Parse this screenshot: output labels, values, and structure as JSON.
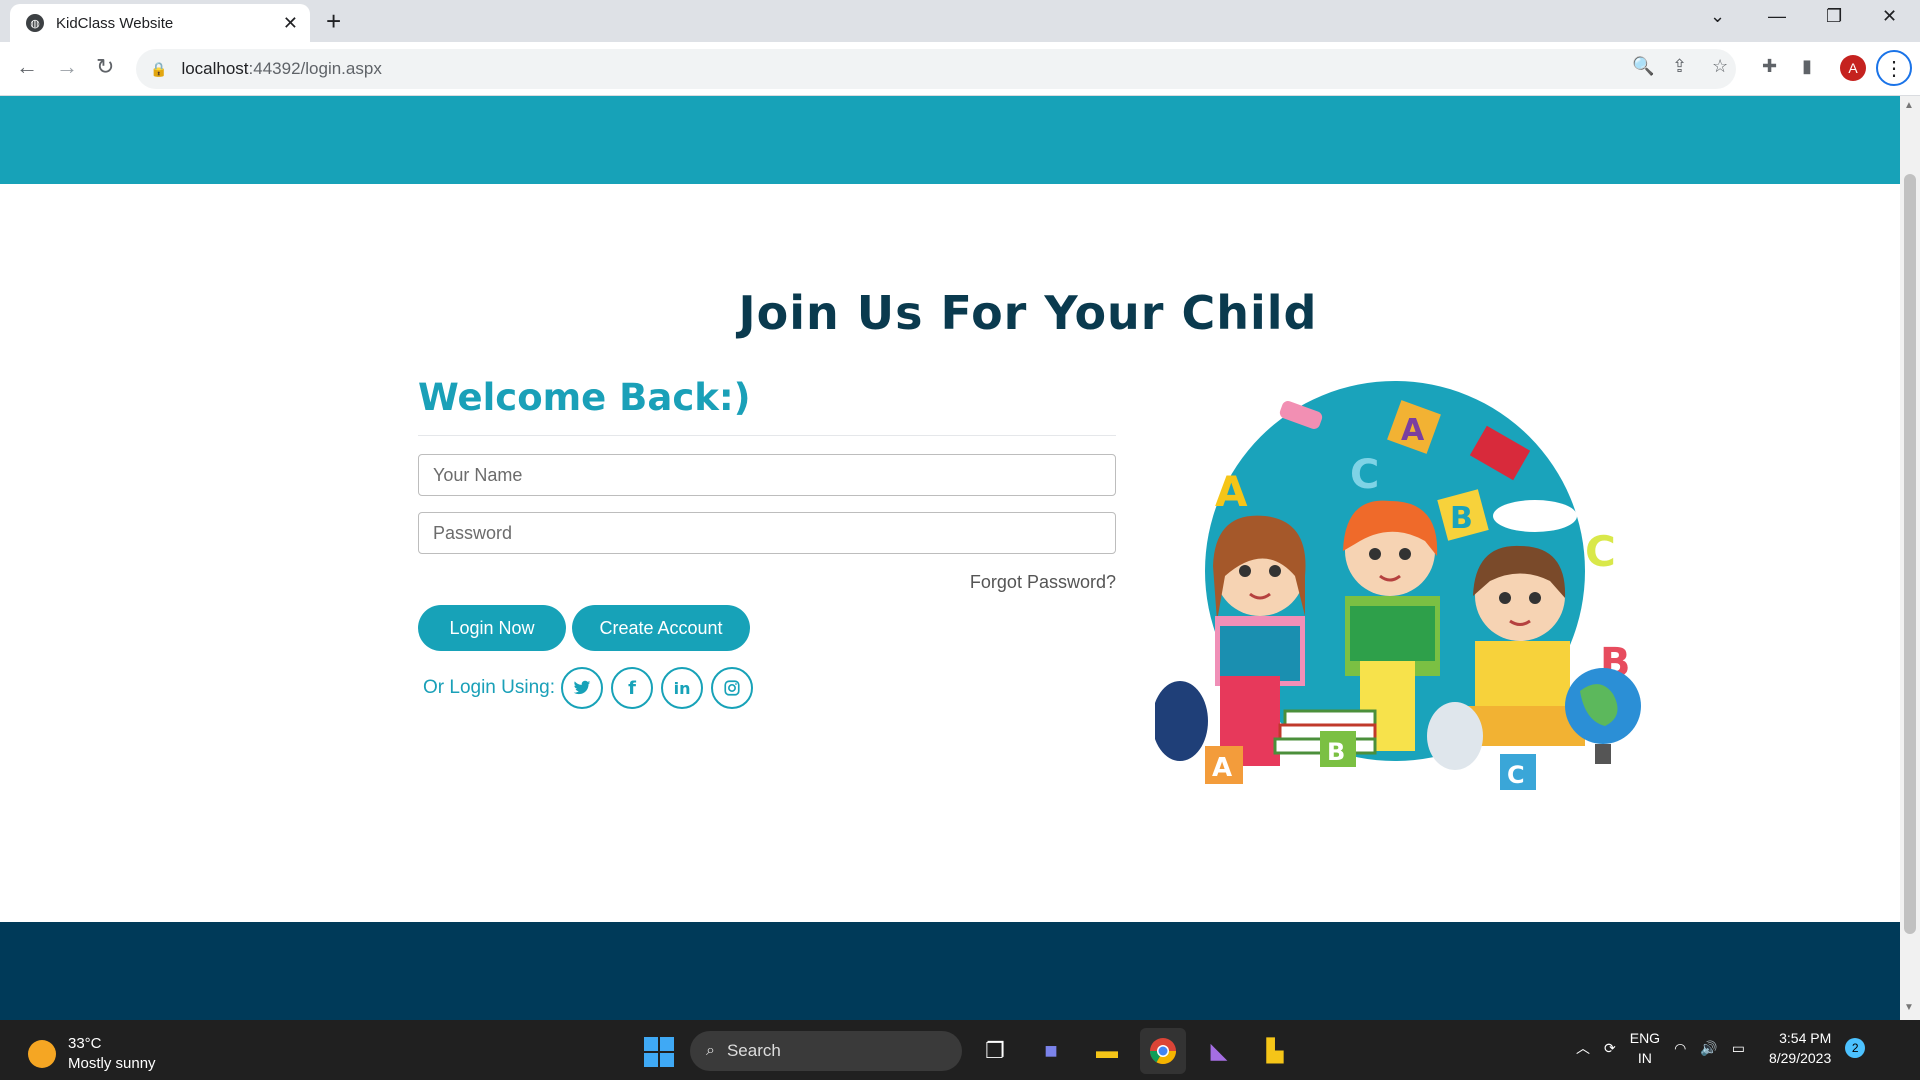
{
  "browser": {
    "tab_title": "KidClass Website",
    "url_host": "localhost",
    "url_rest": ":44392/login.aspx",
    "profile_initial": "A"
  },
  "page": {
    "headline": "Join Us For Your Child",
    "welcome": "Welcome Back:)",
    "name_placeholder": "Your Name",
    "password_placeholder": "Password",
    "forgot_label": "Forgot Password?",
    "login_button": "Login Now",
    "create_button": "Create Account",
    "social_label": "Or Login Using:",
    "social_icons": [
      "twitter-icon",
      "facebook-icon",
      "linkedin-icon",
      "instagram-icon"
    ],
    "accent_color": "#17a2b8",
    "footer_color": "#003a59"
  },
  "taskbar": {
    "temperature": "33°C",
    "weather": "Mostly sunny",
    "search_label": "Search",
    "lang_line1": "ENG",
    "lang_line2": "IN",
    "time": "3:54 PM",
    "date": "8/29/2023",
    "notifications": "2"
  }
}
